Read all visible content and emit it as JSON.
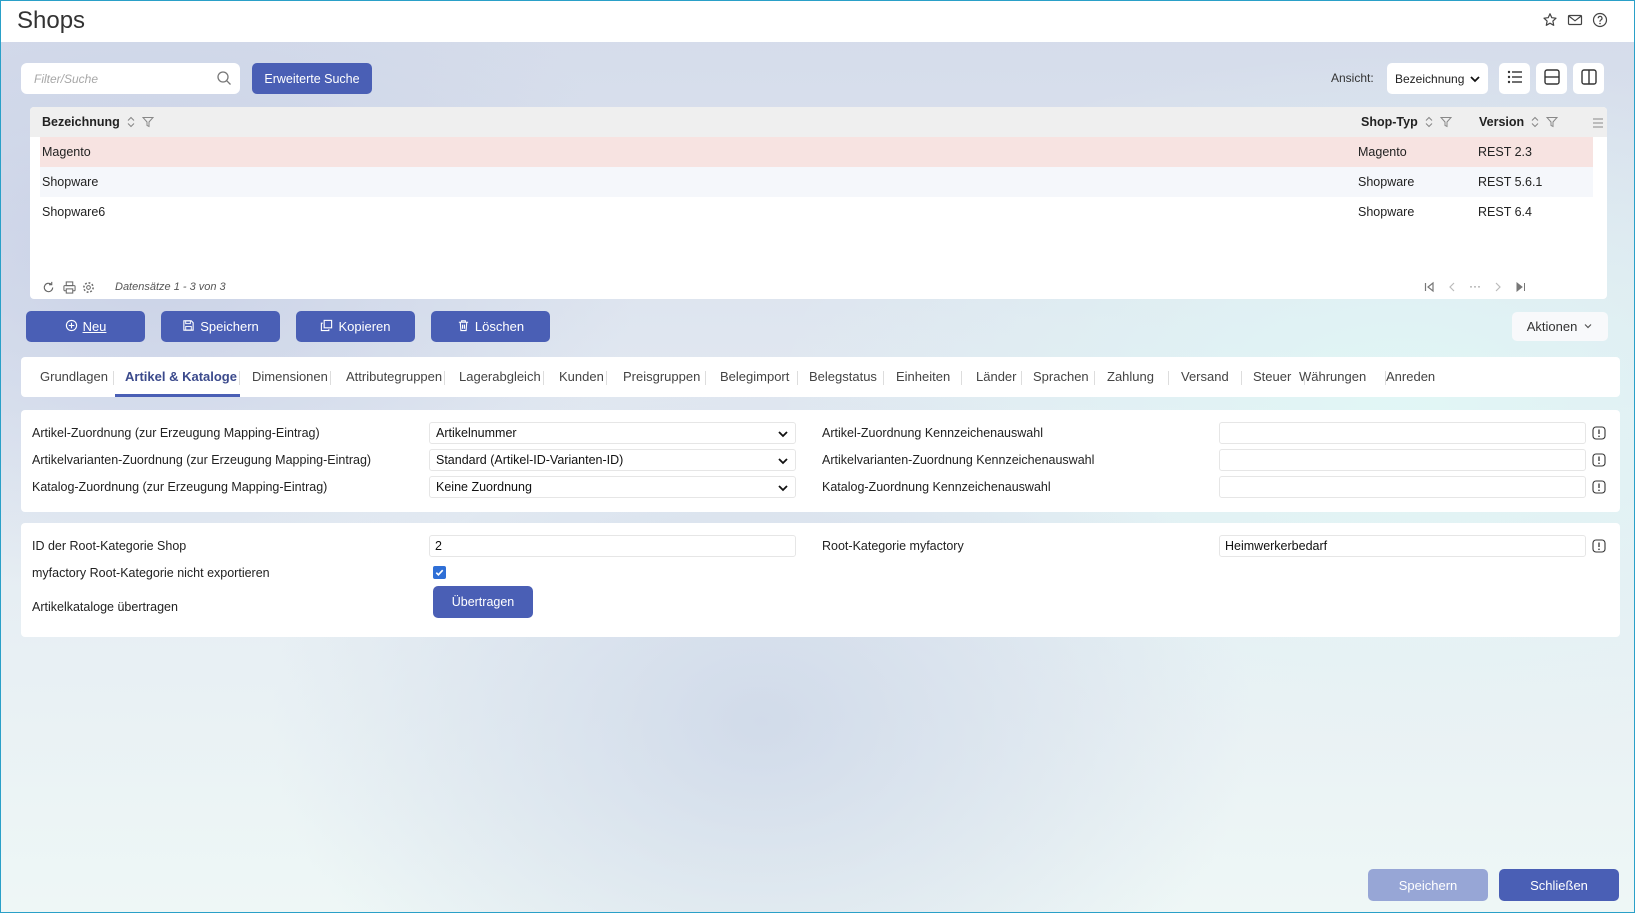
{
  "window": {
    "title": "Shops"
  },
  "header_icons": [
    "star-icon",
    "mail-icon",
    "help-icon"
  ],
  "search": {
    "placeholder": "Filter/Suche",
    "advanced_label": "Erweiterte Suche"
  },
  "view": {
    "label": "Ansicht:",
    "selected": "Bezeichnung"
  },
  "grid": {
    "columns": [
      "Bezeichnung",
      "Shop-Typ",
      "Version"
    ],
    "rows": [
      {
        "name": "Magento",
        "type": "Magento",
        "version": "REST 2.3"
      },
      {
        "name": "Shopware",
        "type": "Shopware",
        "version": "REST 5.6.1"
      },
      {
        "name": "Shopware6",
        "type": "Shopware",
        "version": "REST 6.4"
      }
    ],
    "records": "Datensätze 1 - 3 von 3",
    "pager_more": "···"
  },
  "actions": {
    "new": "Neu",
    "save": "Speichern",
    "copy": "Kopieren",
    "delete": "Löschen",
    "more": "Aktionen"
  },
  "tabs": [
    "Grundlagen",
    "Artikel & Kataloge",
    "Dimensionen",
    "Attributegruppen",
    "Lagerabgleich",
    "Kunden",
    "Preisgruppen",
    "Belegimport",
    "Belegstatus",
    "Einheiten",
    "Länder",
    "Sprachen",
    "Zahlung",
    "Versand",
    "Steuer",
    "Währungen",
    "Anreden"
  ],
  "active_tab": "Artikel & Kataloge",
  "mapping": {
    "article_label": "Artikel-Zuordnung (zur Erzeugung Mapping-Eintrag)",
    "article_value": "Artikelnummer",
    "variant_label": "Artikelvarianten-Zuordnung (zur Erzeugung Mapping-Eintrag)",
    "variant_value": "Standard (Artikel-ID-Varianten-ID)",
    "catalog_label": "Katalog-Zuordnung (zur Erzeugung Mapping-Eintrag)",
    "catalog_value": "Keine Zuordnung",
    "article_flag_label": "Artikel-Zuordnung Kennzeichenauswahl",
    "article_flag_value": "",
    "variant_flag_label": "Artikelvarianten-Zuordnung Kennzeichenauswahl",
    "variant_flag_value": "",
    "catalog_flag_label": "Katalog-Zuordnung Kennzeichenauswahl",
    "catalog_flag_value": ""
  },
  "root": {
    "id_label": "ID der Root-Kategorie Shop",
    "id_value": "2",
    "category_label": "Root-Kategorie myfactory",
    "category_value": "Heimwerkerbedarf",
    "noexport_label": "myfactory Root-Kategorie nicht exportieren",
    "noexport_checked": true,
    "transfer_label": "Artikelkataloge übertragen",
    "transfer_button": "Übertragen"
  },
  "footer": {
    "save": "Speichern",
    "close": "Schließen"
  },
  "colors": {
    "primary": "#4a5fb5",
    "primary_disabled": "#97a6d6",
    "selected_row": "#f7e3e1"
  }
}
